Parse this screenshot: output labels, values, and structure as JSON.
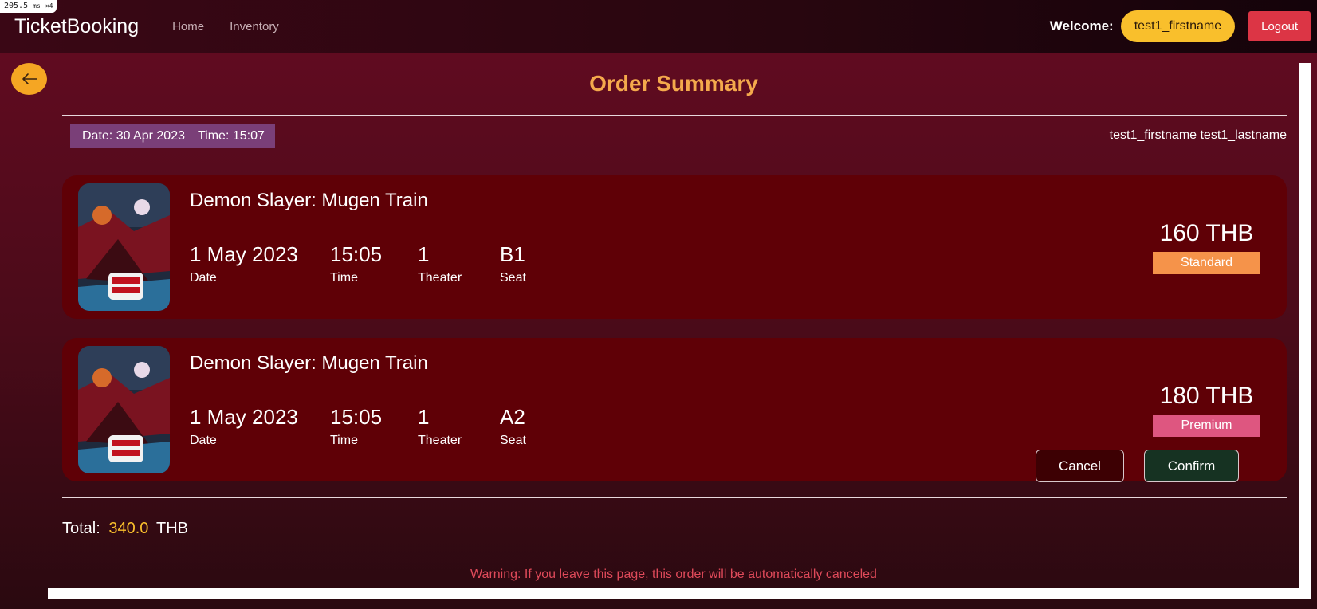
{
  "perf_badge": {
    "value": "205.5",
    "unit": "ms",
    "mult": "×4"
  },
  "navbar": {
    "brand": "TicketBooking",
    "links": [
      "Home",
      "Inventory"
    ],
    "welcome_label": "Welcome:",
    "username": "test1_firstname",
    "logout_label": "Logout"
  },
  "page": {
    "title": "Order Summary",
    "date_label": "Date: 30 Apr 2023",
    "time_label": "Time: 15:07",
    "customer_name": "test1_firstname test1_lastname"
  },
  "labels": {
    "date": "Date",
    "time": "Time",
    "theater": "Theater",
    "seat": "Seat"
  },
  "tickets": [
    {
      "movie": "Demon Slayer: Mugen Train",
      "date": "1 May 2023",
      "time": "15:05",
      "theater": "1",
      "seat": "B1",
      "price": "160 THB",
      "tier": "Standard",
      "tier_color": "#f5934a"
    },
    {
      "movie": "Demon Slayer: Mugen Train",
      "date": "1 May 2023",
      "time": "15:05",
      "theater": "1",
      "seat": "A2",
      "price": "180 THB",
      "tier": "Premium",
      "tier_color": "#de5680"
    }
  ],
  "total": {
    "label": "Total:",
    "amount": "340.0",
    "currency": "THB"
  },
  "actions": {
    "cancel": "Cancel",
    "confirm": "Confirm"
  },
  "warning": "Warning: If you leave this page, this order will be automatically canceled",
  "colors": {
    "accent_yellow": "#f9bf2c",
    "title_orange": "#f4a94c",
    "logout_red": "#dc3545",
    "ticket_bg": "#5f0006",
    "warning": "#e04a5a"
  }
}
